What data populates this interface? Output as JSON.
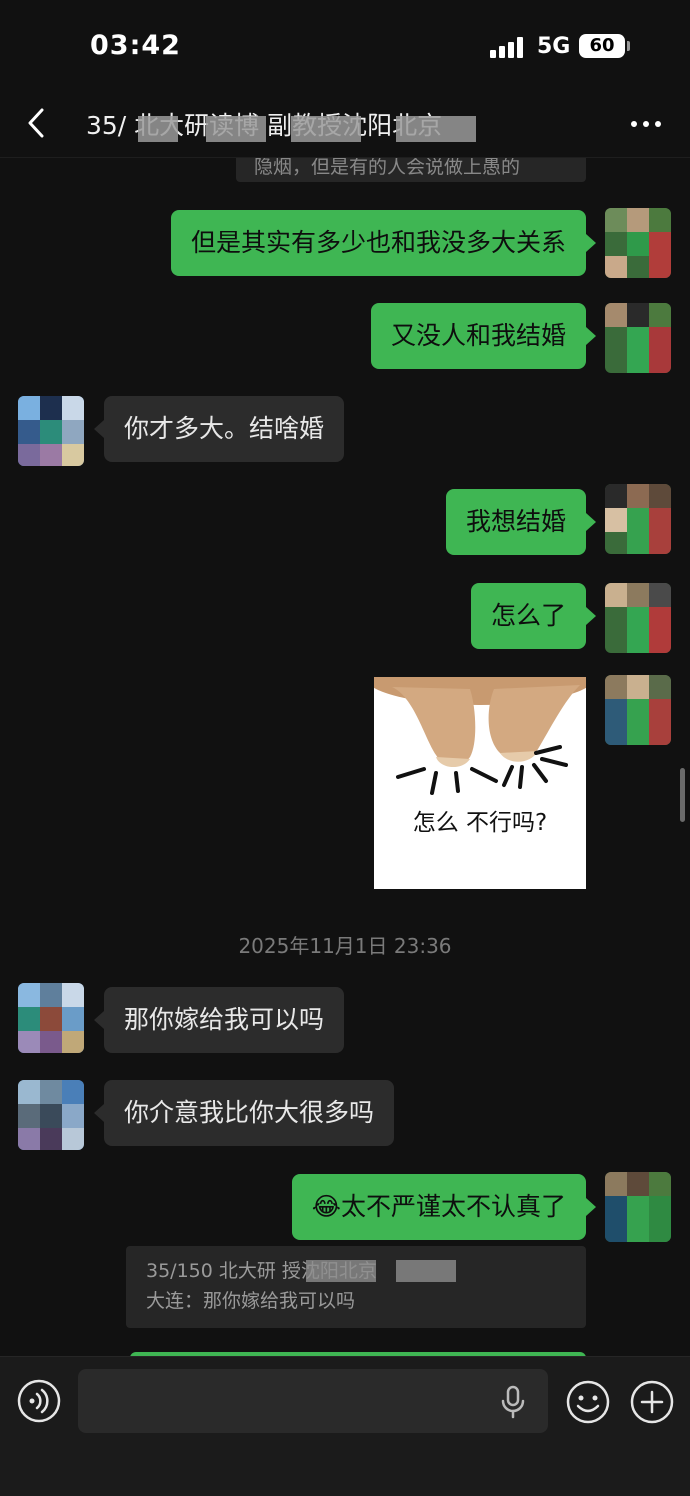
{
  "status_bar": {
    "time": "03:42",
    "network": "5G",
    "battery": "60"
  },
  "header": {
    "title": "35/     北大研读博     副教授沈阳北京",
    "back_icon": "chevron-left-icon",
    "more_icon": "more-dots-icon"
  },
  "messages": {
    "quote_top": "隐烟，但是有的人会说做上愚的",
    "m1": "但是其实有多少也和我没多大关系",
    "m2": "又没人和我结婚",
    "m3": "你才多大。结啥婚",
    "m4": "我想结婚",
    "m5": "怎么了",
    "sticker_caption": "怎么  不行吗?",
    "timestamp": "2025年11月1日 23:36",
    "m6": "那你嫁给我可以吗",
    "m7": "你介意我比你大很多吗",
    "m8_emoji": "😂",
    "m8": "太不严谨太不认真了",
    "quote_bottom_line1": "35/150 北大研                     授沈阳北京",
    "quote_bottom_line2": "大连：那你嫁给我可以吗"
  },
  "input_bar": {
    "placeholder": "",
    "voice_icon": "voice-mode-icon",
    "mic_icon": "microphone-icon",
    "emoji_icon": "emoji-icon",
    "plus_icon": "plus-icon"
  },
  "colors": {
    "outgoing_bubble": "#3fb653",
    "incoming_bubble": "#2c2c2c",
    "background": "#111111"
  }
}
